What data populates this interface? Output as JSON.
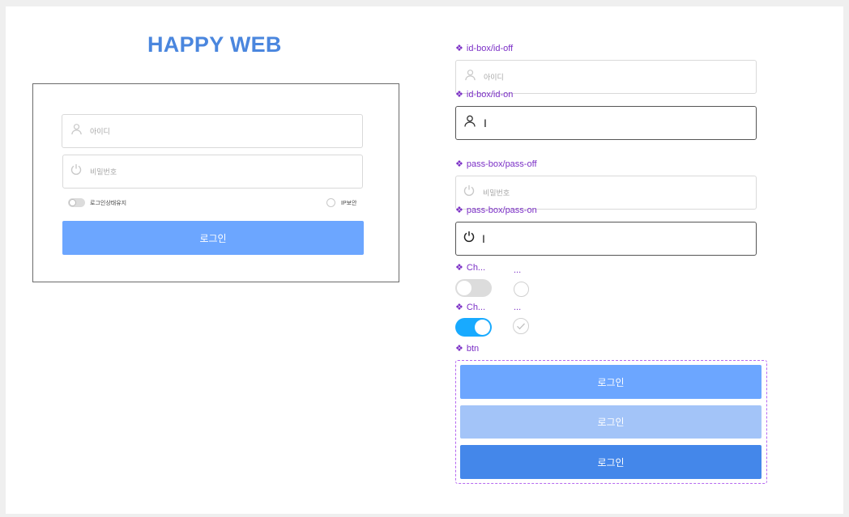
{
  "app": {
    "title": "HAPPY WEB"
  },
  "login_form": {
    "id_placeholder": "아이디",
    "pw_placeholder": "비밀번호",
    "keep_login_label": "로그인상태유지",
    "ip_security_label": "IP보안",
    "login_button": "로그인"
  },
  "components": {
    "id_off": {
      "label": "id-box/id-off",
      "placeholder": "아이디"
    },
    "id_on": {
      "label": "id-box/id-on",
      "value": "I"
    },
    "pass_off": {
      "label": "pass-box/pass-off",
      "placeholder": "비밀번호"
    },
    "pass_on": {
      "label": "pass-box/pass-on",
      "value": "I"
    },
    "check_off": {
      "label": "Ch...",
      "radio_label": "..."
    },
    "check_on": {
      "label": "Ch...",
      "radio_label": "..."
    },
    "btn": {
      "label": "btn",
      "states": [
        "로그인",
        "로그인",
        "로그인"
      ]
    }
  },
  "colors": {
    "title": "#4a86de",
    "btn_default": "#6ca6ff",
    "btn_disabled": "#a3c4f8",
    "btn_active": "#4487ea",
    "toggle_on": "#18aaff",
    "toggle_off": "#dcdcdc",
    "component_label": "#7b2fc6"
  },
  "icons": [
    "user-icon",
    "power-icon",
    "check-icon",
    "component-icon"
  ]
}
